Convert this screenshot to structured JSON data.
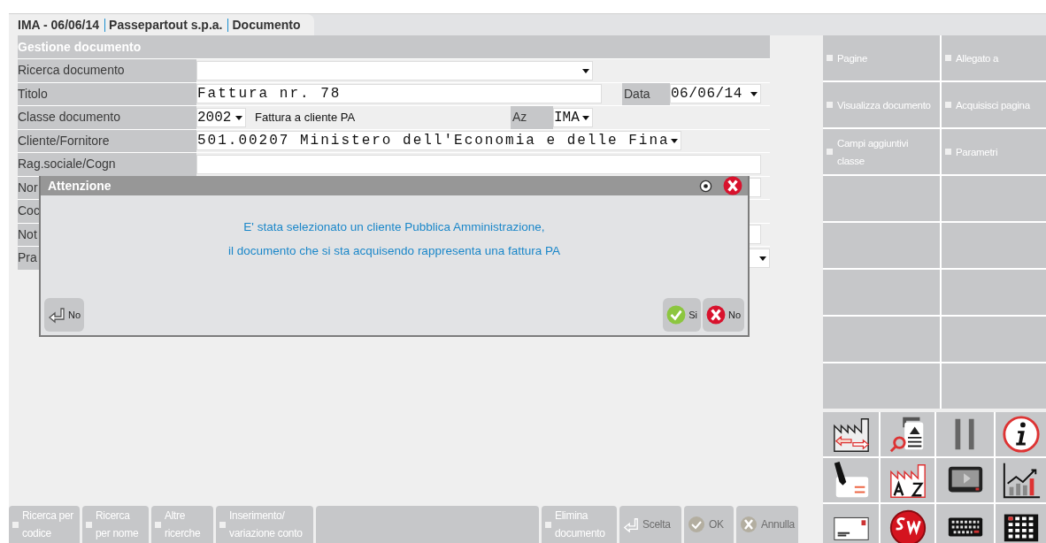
{
  "breadcrumb": [
    "IMA - 06/06/14",
    "Passepartout s.p.a.",
    "Documento"
  ],
  "form": {
    "title": "Gestione documento",
    "rows": [
      {
        "kind": "search",
        "label": "Ricerca documento"
      },
      {
        "kind": "title",
        "label": "Titolo",
        "value": "Fattura nr. 78",
        "extra_label": "Data",
        "extra_value": "06/06/14"
      },
      {
        "kind": "class",
        "label": "Classe documento",
        "value": "2002",
        "description": "Fattura a cliente PA",
        "extra_label": "Az",
        "extra_value": "IMA"
      },
      {
        "kind": "client",
        "label": "Cliente/Fornitore",
        "value": "501.00207 Ministero dell'Economia e delle Fina"
      },
      {
        "kind": "text",
        "label": "Rag.sociale/Cogn"
      },
      {
        "kind": "text",
        "label": "Nor"
      },
      {
        "kind": "blank",
        "label": "Coc"
      },
      {
        "kind": "text",
        "label": "Not"
      },
      {
        "kind": "select",
        "label": "Pra"
      }
    ]
  },
  "dialog": {
    "title": "Attenzione",
    "message": [
      "E' stata selezionato un cliente Pubblica Amministrazione,",
      "il documento che si sta acquisendo rappresenta una fattura PA"
    ],
    "left_buttons": [
      {
        "kind": "enter",
        "label": "No"
      }
    ],
    "right_buttons": [
      {
        "kind": "yes",
        "label": "Si"
      },
      {
        "kind": "no",
        "label": "No"
      }
    ]
  },
  "bottom_bar": [
    {
      "kind": "menu",
      "label": "Ricerca per codice",
      "disabled": false
    },
    {
      "kind": "menu",
      "label": "Ricerca per nome",
      "disabled": false
    },
    {
      "kind": "menu",
      "label": "Altre ricerche",
      "disabled": false
    },
    {
      "kind": "menu",
      "label": "Inserimento/ variazione conto",
      "disabled": false
    },
    {
      "kind": "empty"
    },
    {
      "kind": "menu",
      "label": "Elimina documento",
      "disabled": false
    },
    {
      "kind": "enter",
      "label": "Scelta",
      "disabled": true
    },
    {
      "kind": "check",
      "label": "OK",
      "disabled": true
    },
    {
      "kind": "cross",
      "label": "Annulla",
      "disabled": true
    }
  ],
  "side_menu": [
    {
      "kind": "menu",
      "label": "Pagine"
    },
    {
      "kind": "menu",
      "label": "Allegato a"
    },
    {
      "kind": "menu",
      "label": "Visualizza documento"
    },
    {
      "kind": "menu",
      "label": "Acquisisci pagina"
    },
    {
      "kind": "menu",
      "label": "Campi aggiuntivi classe"
    },
    {
      "kind": "menu",
      "label": "Parametri"
    },
    {
      "kind": "empty"
    },
    {
      "kind": "empty"
    },
    {
      "kind": "empty"
    },
    {
      "kind": "empty"
    },
    {
      "kind": "empty"
    },
    {
      "kind": "empty"
    },
    {
      "kind": "empty"
    },
    {
      "kind": "empty"
    },
    {
      "kind": "empty"
    },
    {
      "kind": "empty"
    }
  ],
  "icon_tiles": [
    {
      "kind": "factory-arrows"
    },
    {
      "kind": "search-image"
    },
    {
      "kind": "pause"
    },
    {
      "kind": "info"
    },
    {
      "kind": "pen-card"
    },
    {
      "kind": "factory-az"
    },
    {
      "kind": "monitor"
    },
    {
      "kind": "chart"
    },
    {
      "kind": "envelope"
    },
    {
      "kind": "sw-logo"
    },
    {
      "kind": "keyboard"
    },
    {
      "kind": "grid"
    }
  ]
}
